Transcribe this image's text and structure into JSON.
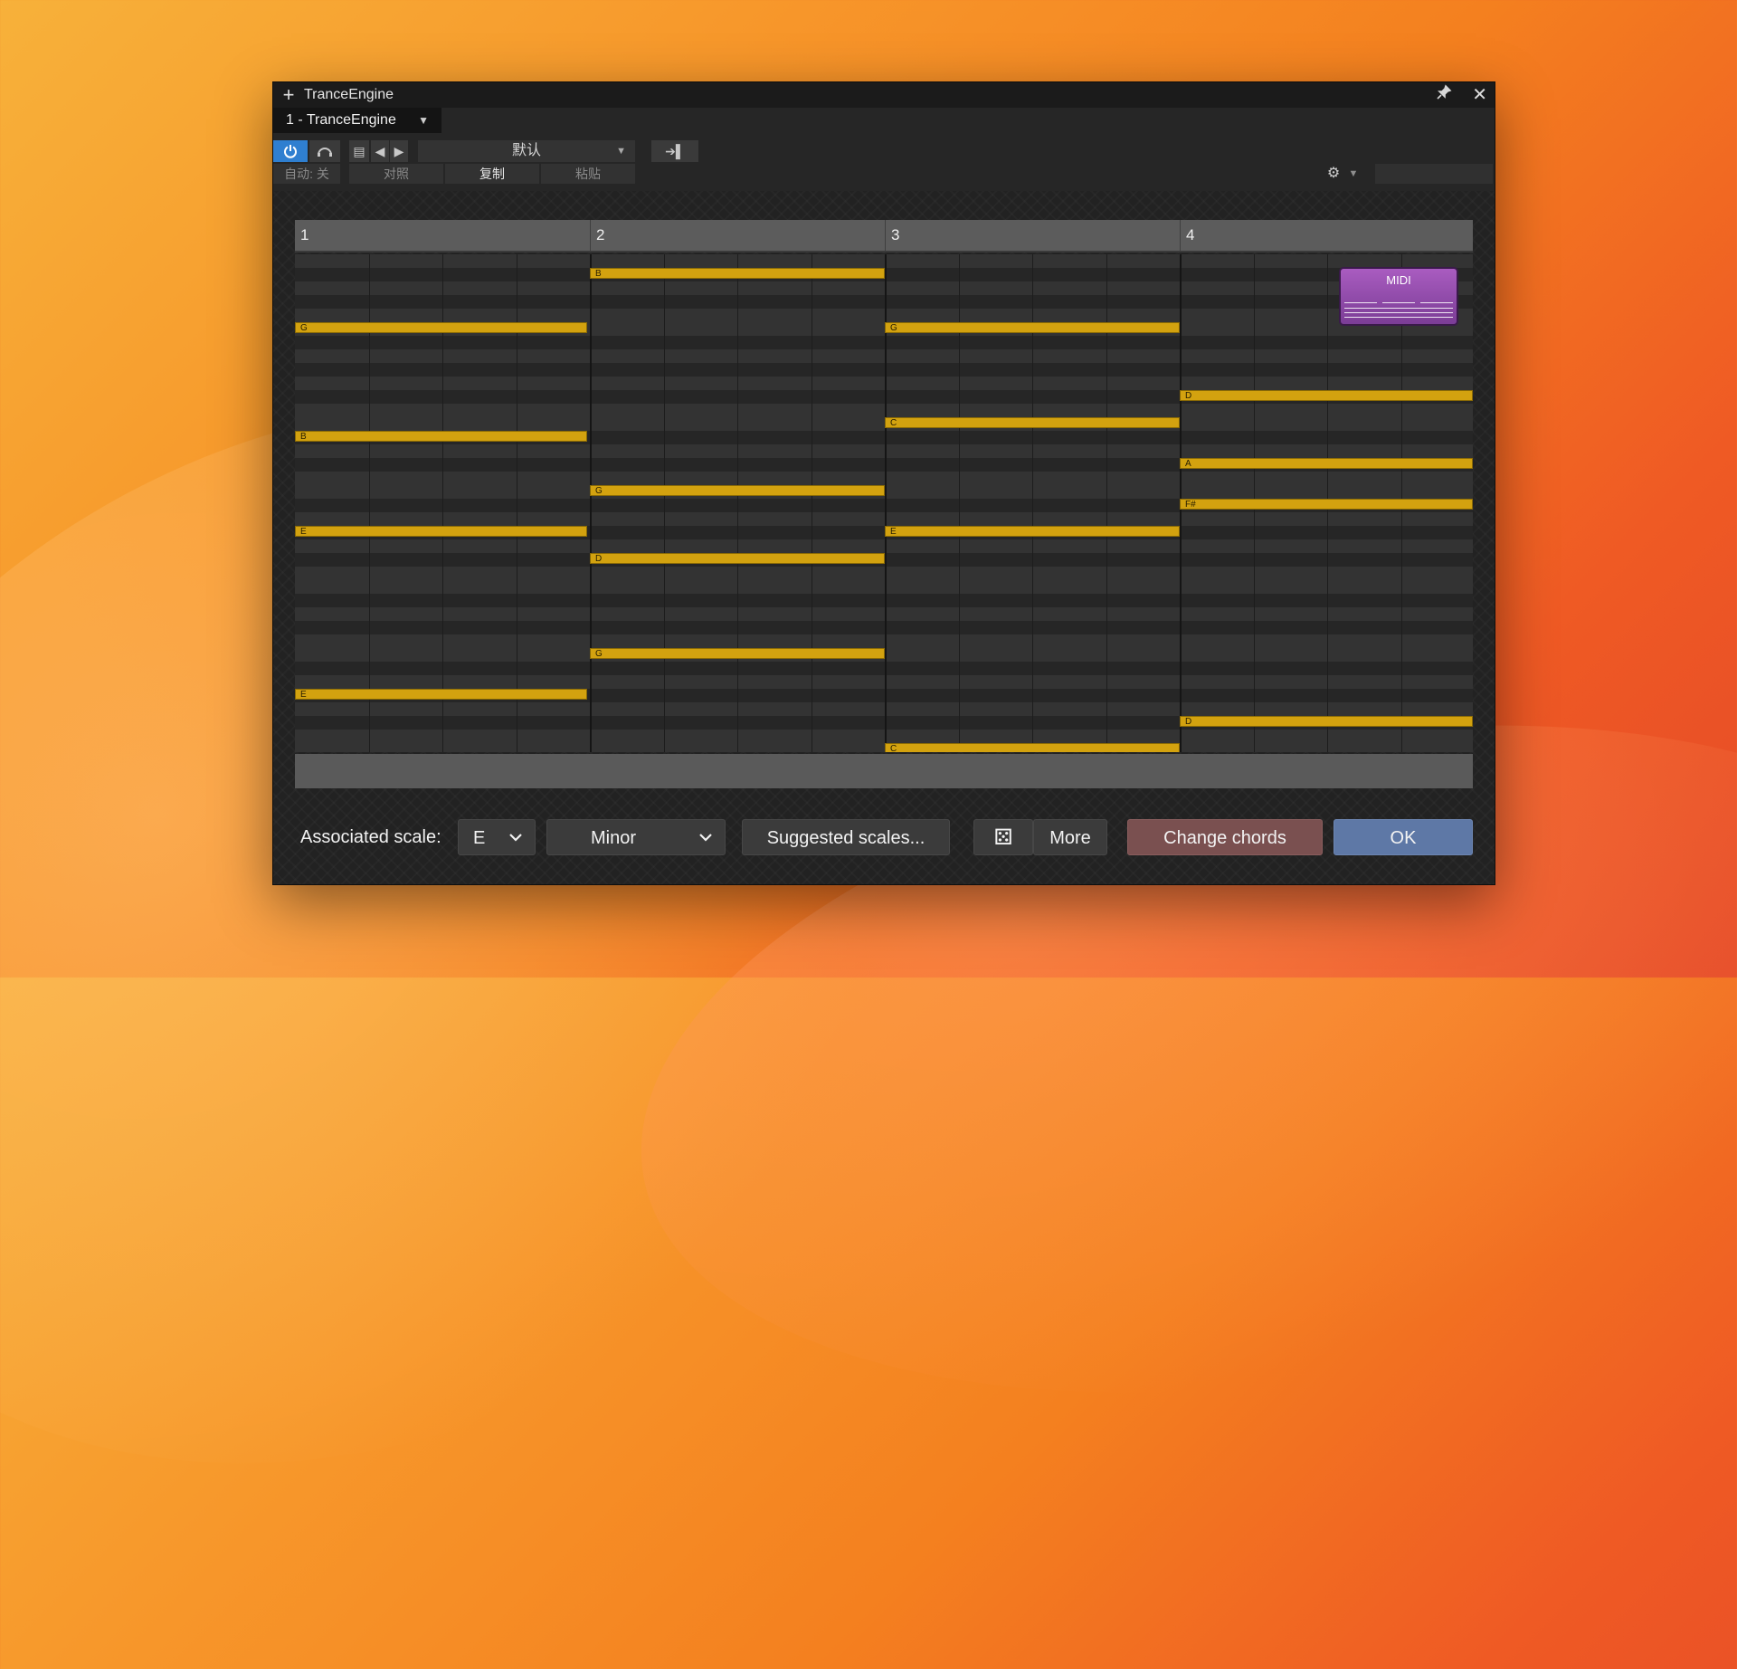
{
  "window": {
    "title": "TranceEngine",
    "instrument_select": "1 - TranceEngine"
  },
  "toolbar": {
    "preset_name": "默认"
  },
  "subbar": {
    "auto_label": "自动: 关",
    "compare_label": "对照",
    "copy_label": "复制",
    "paste_label": "粘贴"
  },
  "ruler": {
    "bars": [
      "1",
      "2",
      "3",
      "4"
    ]
  },
  "midi_button": {
    "label": "MIDI"
  },
  "bottom": {
    "associated_scale_label": "Associated scale:",
    "scale_root": "E",
    "scale_mode": "Minor",
    "suggested_scales_label": "Suggested scales...",
    "more_label": "More",
    "change_chords_label": "Change chords",
    "ok_label": "OK"
  },
  "chords": [
    {
      "bar": 1,
      "notes": [
        "G",
        "B",
        "E",
        "E"
      ]
    },
    {
      "bar": 2,
      "notes": [
        "B",
        "G",
        "D",
        "G"
      ]
    },
    {
      "bar": 3,
      "notes": [
        "G",
        "C",
        "E",
        "C"
      ]
    },
    {
      "bar": 4,
      "notes": [
        "D",
        "A",
        "F#",
        "D"
      ]
    }
  ],
  "colors": {
    "note": "#d3a20f",
    "power": "#2f7fd0",
    "change_chords": "#7a5050",
    "ok": "#5e78a6"
  }
}
